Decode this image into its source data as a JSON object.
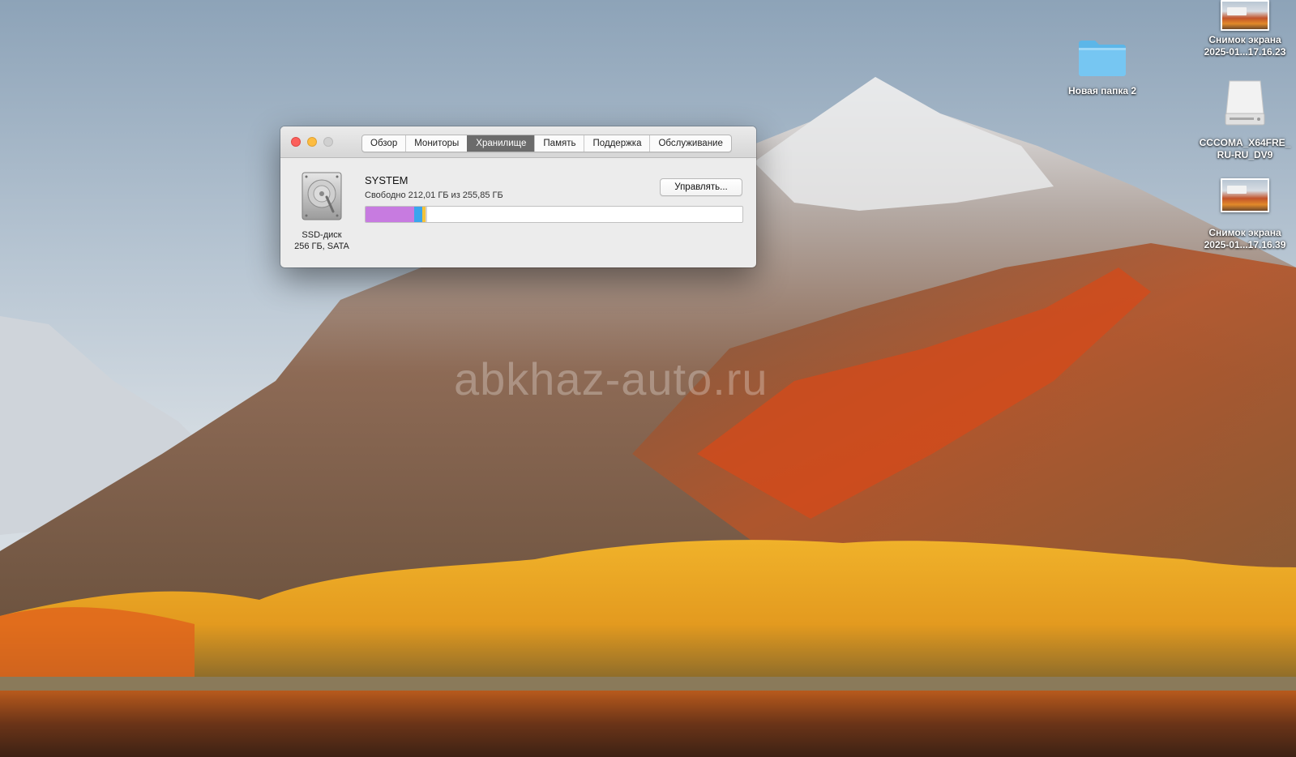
{
  "watermark": "abkhaz-auto.ru",
  "desktop_icons": [
    {
      "id": "screenshot-1",
      "line1": "Снимок экрана",
      "line2": "2025-01...17.16.23"
    },
    {
      "id": "folder",
      "line1": "Новая папка 2"
    },
    {
      "id": "disk-image",
      "line1": "CCCOMA_X64FRE_",
      "line2": "RU-RU_DV9"
    },
    {
      "id": "screenshot-2",
      "line1": "Снимок экрана",
      "line2": "2025-01...17.16.39"
    }
  ],
  "window": {
    "tabs": [
      {
        "label": "Обзор"
      },
      {
        "label": "Мониторы"
      },
      {
        "label": "Хранилище",
        "active": true
      },
      {
        "label": "Память"
      },
      {
        "label": "Поддержка"
      },
      {
        "label": "Обслуживание"
      }
    ],
    "disk": {
      "caption_line1": "SSD-диск",
      "caption_line2": "256 ГБ, SATA"
    },
    "volume": {
      "name": "SYSTEM",
      "free_text": "Свободно 212,01 ГБ из 255,85 ГБ"
    },
    "manage_button": "Управлять...",
    "storage_segments": [
      {
        "kind": "apps",
        "percent": 13,
        "color": "#c77be0"
      },
      {
        "kind": "system",
        "percent": 2,
        "color": "#3aa5ee"
      },
      {
        "kind": "other",
        "percent": 1,
        "color": "#f4c33c"
      },
      {
        "kind": "purgeable",
        "percent": 0.4,
        "color": "#d6d6d6"
      }
    ]
  }
}
